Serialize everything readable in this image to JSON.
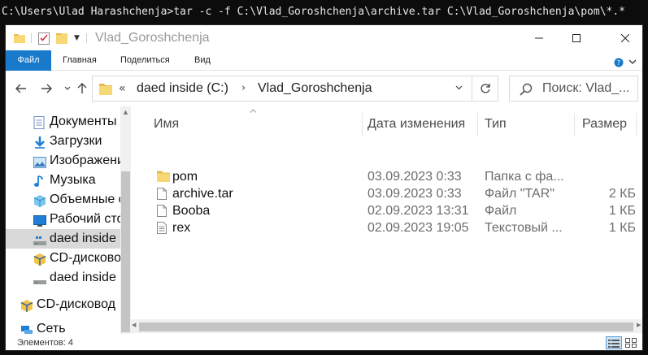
{
  "console": {
    "line": "C:\\Users\\Ulad Harashchenja>tar -c -f C:\\Vlad_Goroshchenja\\archive.tar C:\\Vlad_Goroshchenja\\pom\\*.*"
  },
  "window": {
    "title": "Vlad_Goroshchenja"
  },
  "ribbon": {
    "tabs": [
      {
        "label": "Файл"
      },
      {
        "label": "Главная"
      },
      {
        "label": "Поделиться"
      },
      {
        "label": "Вид"
      }
    ]
  },
  "address": {
    "overflow_glyph": "«",
    "segments": [
      "daed inside (C:)",
      "Vlad_Goroshchenja"
    ],
    "separator": "›"
  },
  "search": {
    "placeholder": "Поиск: Vlad_..."
  },
  "nav_pane": {
    "items": [
      {
        "label": "Документы",
        "icon": "documents-icon"
      },
      {
        "label": "Загрузки",
        "icon": "downloads-icon"
      },
      {
        "label": "Изображения",
        "icon": "pictures-icon"
      },
      {
        "label": "Музыка",
        "icon": "music-icon"
      },
      {
        "label": "Объемные объекты",
        "icon": "3d-objects-icon"
      },
      {
        "label": "Рабочий стол",
        "icon": "desktop-icon"
      },
      {
        "label": "daed inside (C:)",
        "icon": "drive-icon",
        "selected": true
      },
      {
        "label": "CD-дисковод",
        "icon": "cd-drive-icon"
      },
      {
        "label": "daed inside (C:)",
        "icon": "drive-icon"
      },
      {
        "label": "CD-дисковод",
        "icon": "cd-drive-icon"
      },
      {
        "label": "Сеть",
        "icon": "network-icon"
      }
    ]
  },
  "file_list": {
    "columns": {
      "name": "Имя",
      "date": "Дата изменения",
      "type": "Тип",
      "size": "Размер"
    },
    "rows": [
      {
        "name": "pom",
        "date": "03.09.2023 0:33",
        "type": "Папка с фа...",
        "size": "",
        "icon": "folder-icon"
      },
      {
        "name": "archive.tar",
        "date": "03.09.2023 0:33",
        "type": "Файл \"TAR\"",
        "size": "2 КБ",
        "icon": "file-icon"
      },
      {
        "name": "Booba",
        "date": "02.09.2023 13:31",
        "type": "Файл",
        "size": "1 КБ",
        "icon": "file-icon"
      },
      {
        "name": "rex",
        "date": "02.09.2023 19:05",
        "type": "Текстовый ...",
        "size": "1 КБ",
        "icon": "text-file-icon"
      }
    ]
  },
  "status": {
    "items_count": "Элементов: 4"
  },
  "colors": {
    "accent": "#1979ca",
    "folder": "#f8d775",
    "selection": "#d9d9d9"
  }
}
